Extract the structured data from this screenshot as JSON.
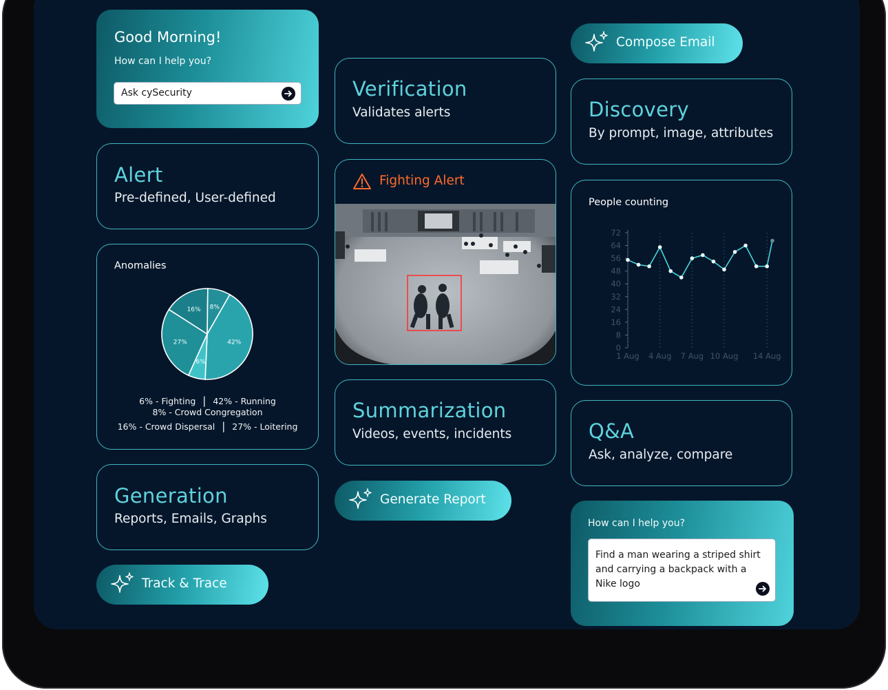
{
  "greeting": {
    "title": "Good Morning!",
    "subtitle": "How can I help you?",
    "input_value": "Ask cySecurity"
  },
  "cards": {
    "alert": {
      "title": "Alert",
      "subtitle": "Pre-defined, User-defined"
    },
    "verification": {
      "title": "Verification",
      "subtitle": "Validates alerts"
    },
    "discovery": {
      "title": "Discovery",
      "subtitle": "By prompt, image, attributes"
    },
    "summarization": {
      "title": "Summarization",
      "subtitle": "Videos, events, incidents"
    },
    "qa": {
      "title": "Q&A",
      "subtitle": "Ask, analyze, compare"
    },
    "generation": {
      "title": "Generation",
      "subtitle": "Reports, Emails, Graphs"
    }
  },
  "anomalies": {
    "title": "Anomalies",
    "legend": {
      "fighting": "6% - Fighting",
      "running": "42% - Running",
      "crowd_congregation": "8% - Crowd Congregation",
      "crowd_dispersal": "16% - Crowd Dispersal",
      "loitering": "27% - Loitering"
    },
    "separator": "|"
  },
  "fighting_alert": {
    "title": "Fighting Alert",
    "icon": "warning-icon",
    "color": "#ff6a2b"
  },
  "buttons": {
    "compose_email": "Compose Email",
    "generate_report": "Generate Report",
    "track_trace": "Track & Trace"
  },
  "help_panel": {
    "title": "How can I help you?",
    "query": "Find a man wearing a striped shirt and carrying a backpack with a Nike logo"
  },
  "colors": {
    "accent": "#5fd2dd",
    "background": "#06162a",
    "border": "#3fb7c2"
  },
  "chart_data": [
    {
      "type": "pie",
      "title": "",
      "categories": [
        "42%",
        "6%",
        "27%",
        "16%",
        "8%"
      ],
      "values": [
        42,
        6,
        27,
        16,
        8
      ]
    },
    {
      "type": "line",
      "title": "People counting",
      "y_ticks": [
        "72",
        "64",
        "56",
        "48",
        "40",
        "32",
        "24",
        "16",
        "8",
        "0"
      ],
      "x_ticks": [
        "1 Aug",
        "4 Aug",
        "7 Aug",
        "10 Aug",
        "14 Aug"
      ],
      "ylim": [
        0,
        72
      ],
      "xlim": [
        1,
        14.5
      ],
      "x": [
        1,
        2,
        3,
        4,
        5,
        6,
        7,
        8,
        9,
        10,
        11,
        12,
        13,
        14
      ],
      "values": [
        55,
        52,
        51,
        63,
        48,
        44,
        56,
        58,
        54,
        49,
        60,
        64,
        51,
        51
      ],
      "last_point": {
        "x": 14.5,
        "value": 67
      }
    }
  ]
}
